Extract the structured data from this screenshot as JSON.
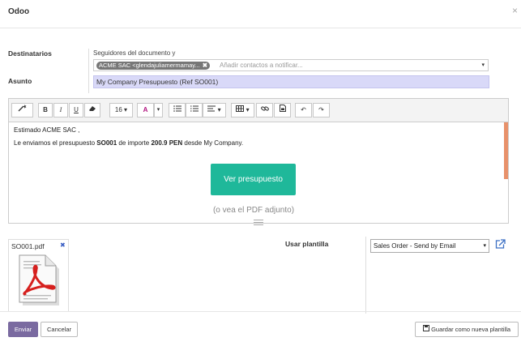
{
  "dialog": {
    "title": "Odoo",
    "close_glyph": "×"
  },
  "form": {
    "recipients_label": "Destinatarios",
    "followers_text": "Seguidores del documento y",
    "recipient_tag": "ACME SAC <glendajuliamermamay...",
    "recipients_placeholder": "Añadir contactos a notificar...",
    "subject_label": "Asunto",
    "subject_value": "My Company Presupuesto (Ref SO001)"
  },
  "toolbar": {
    "font_size": "16",
    "bold": "B",
    "italic": "I",
    "underline": "U"
  },
  "body": {
    "greeting": "Estimado ACME SAC ,",
    "line_prefix": "Le enviamos el presupuesto ",
    "order_ref": "SO001",
    "line_mid": " de importe ",
    "amount": "200.9 PEN",
    "line_suffix": " desde My Company.",
    "view_button": "Ver presupuesto",
    "pdf_note": "(o vea el PDF adjunto)"
  },
  "attachment": {
    "filename": "SO001.pdf",
    "remove_glyph": "✖"
  },
  "template": {
    "label": "Usar plantilla",
    "selected": "Sales Order - Send by Email"
  },
  "footer": {
    "send": "Enviar",
    "cancel": "Cancelar",
    "save_template": "Guardar como nueva plantilla"
  },
  "colors": {
    "accent": "#7a6aa0",
    "view_button": "#1fb89a",
    "subject_bg": "#d9d9f8",
    "scrollbar": "#e8916a"
  }
}
